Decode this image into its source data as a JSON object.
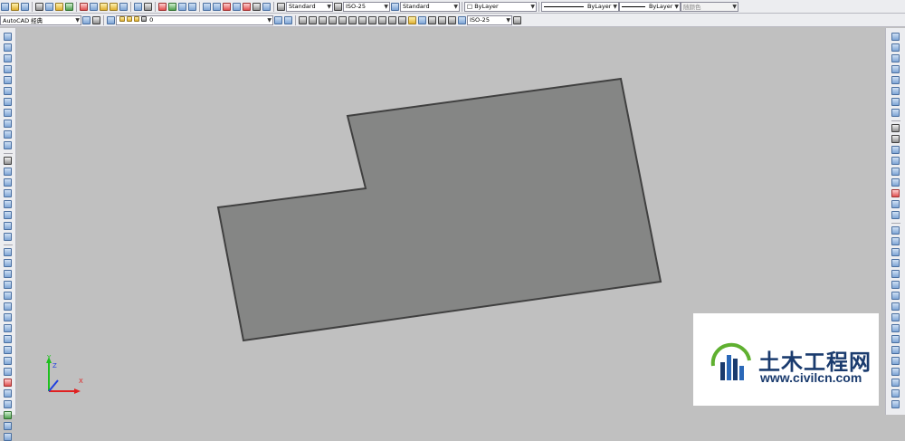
{
  "toolbar": {
    "text_style": "Standard",
    "dim_style": "ISO-25",
    "table_style": "Standard",
    "layer_color": "ByLayer",
    "linetype": "ByLayer",
    "lineweight": "ByLayer",
    "plot_style": "随颜色",
    "workspace": "AutoCAD 经典",
    "layer_name": "0",
    "multileader_style": "ISO-25"
  },
  "watermark": {
    "title": "土木工程网",
    "url": "www.civilcn.com"
  },
  "ucs": {
    "x_label": "X",
    "y_label": "Y",
    "z_label": "Z"
  },
  "colors": {
    "shape_fill": "#858685",
    "shape_stroke": "#404040",
    "canvas_bg": "#c0c0c0",
    "logo_blue": "#1a3b6e",
    "logo_green": "#5fb030"
  }
}
